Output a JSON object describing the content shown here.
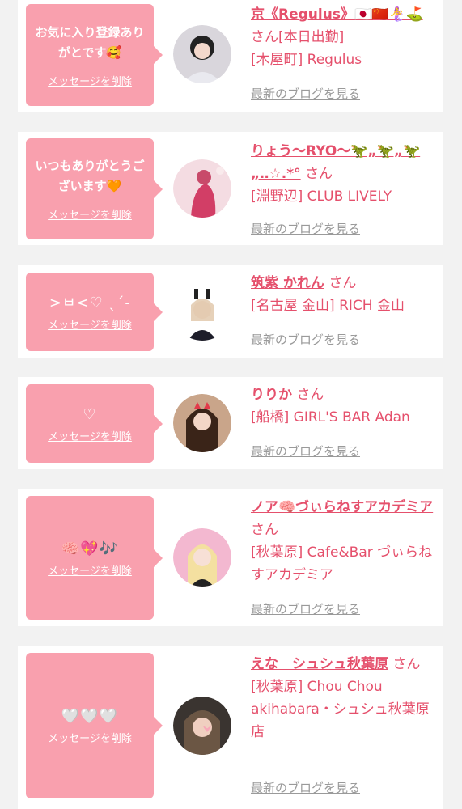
{
  "cards": [
    {
      "message": "お気に入り登録ありがとです🥰",
      "delete_label": "メッセージを削除",
      "name": "京《Regulus》🇯🇵🇨🇳🧜‍♀️⛳",
      "san": "さん",
      "extra": "[本日出勤]",
      "shop": "[木屋町] Regulus",
      "blog_label": "最新のブログを見る"
    },
    {
      "message": "いつもありがとうございます🧡",
      "delete_label": "メッセージを削除",
      "name": "りょう〜RYO〜🦖„🦖„🦖„‥☆.*°",
      "san": "さん",
      "shop": "[淵野辺] CLUB LIVELY",
      "blog_label": "最新のブログを見る"
    },
    {
      "message": ">ㅂ<♡ ˎˊ˗",
      "delete_label": "メッセージを削除",
      "name": "筑紫 かれん",
      "san": "さん",
      "shop": "[名古屋 金山] RICH 金山",
      "blog_label": "最新のブログを見る"
    },
    {
      "message": "♡",
      "delete_label": "メッセージを削除",
      "name": "りりか",
      "san": "さん",
      "shop": "[船橋] GIRL'S BAR Adan",
      "blog_label": "最新のブログを見る"
    },
    {
      "message": "🧠💖🎶",
      "delete_label": "メッセージを削除",
      "name": "ノア🧠づぃらねすアカデミア",
      "san": "さん",
      "shop": "[秋葉原] Cafe&Bar づぃらねすアカデミア",
      "blog_label": "最新のブログを見る"
    },
    {
      "message": "🤍🤍🤍",
      "delete_label": "メッセージを削除",
      "name": "えな　シュシュ秋葉原",
      "san": "さん",
      "shop": "[秋葉原] Chou Chou akihabara・シュシュ秋葉原店",
      "blog_label": "最新のブログを見る"
    }
  ],
  "colors": {
    "page_bg": "#f2f2f2",
    "card_bg": "#ffffff",
    "bubble_bg": "#f9a0ae",
    "accent_text": "#e5506c",
    "link_gray": "#9a9a9a"
  },
  "icons": [
    "avatar-photo"
  ]
}
